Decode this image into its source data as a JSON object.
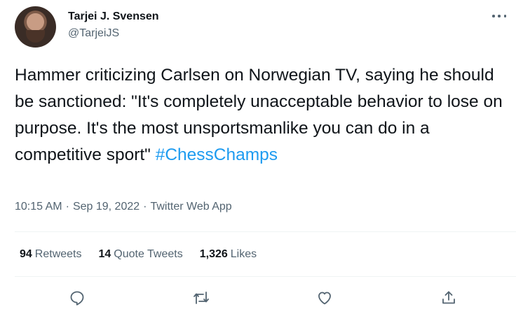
{
  "user": {
    "display_name": "Tarjei J. Svensen",
    "handle": "@TarjeiJS"
  },
  "tweet": {
    "text": "Hammer criticizing Carlsen on Norwegian TV, saying he should be sanctioned: \"It's completely unacceptable behavior to lose on purpose. It's the most unsportsmanlike you can do in a competitive sport\"",
    "hashtag": "#ChessChamps"
  },
  "meta": {
    "time": "10:15 AM",
    "separator": "·",
    "date": "Sep 19, 2022",
    "source": "Twitter Web App"
  },
  "stats": {
    "retweets_count": "94",
    "retweets_label": "Retweets",
    "quotes_count": "14",
    "quotes_label": "Quote Tweets",
    "likes_count": "1,326",
    "likes_label": "Likes"
  },
  "icons": {
    "more": "more-horizontal-icon",
    "reply": "reply-icon",
    "retweet": "retweet-icon",
    "like": "heart-icon",
    "share": "share-icon"
  },
  "colors": {
    "text": "#0f1419",
    "secondary": "#536471",
    "link": "#1d9bf0",
    "divider": "#eff3f4"
  }
}
